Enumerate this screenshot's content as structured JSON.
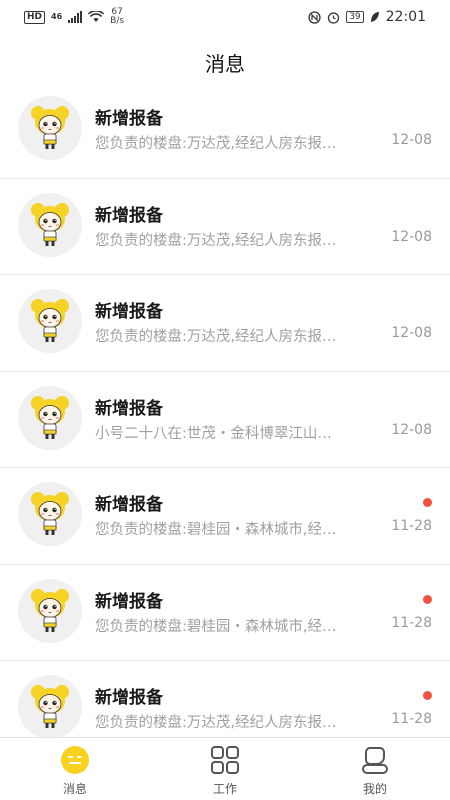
{
  "status_bar": {
    "hd": "HD",
    "network": "46",
    "speed_value": "67",
    "speed_unit": "B/s",
    "battery": "39",
    "time": "22:01"
  },
  "header": {
    "title": "消息"
  },
  "messages": [
    {
      "title": "新增报备",
      "preview": "您负责的楼盘:万达茂,经纪人房东报…",
      "time": "12-08",
      "unread": false,
      "avatar": "bear-avatar-icon"
    },
    {
      "title": "新增报备",
      "preview": "您负责的楼盘:万达茂,经纪人房东报…",
      "time": "12-08",
      "unread": false,
      "avatar": "bear-avatar-icon"
    },
    {
      "title": "新增报备",
      "preview": "您负责的楼盘:万达茂,经纪人房东报…",
      "time": "12-08",
      "unread": false,
      "avatar": "bear-avatar-icon"
    },
    {
      "title": "新增报备",
      "preview": "小号二十八在:世茂・金科博翠江山…",
      "time": "12-08",
      "unread": false,
      "avatar": "bear-avatar-icon"
    },
    {
      "title": "新增报备",
      "preview": "您负责的楼盘:碧桂园・森林城市,经…",
      "time": "11-28",
      "unread": true,
      "avatar": "bear-avatar-icon"
    },
    {
      "title": "新增报备",
      "preview": "您负责的楼盘:碧桂园・森林城市,经…",
      "time": "11-28",
      "unread": true,
      "avatar": "bear-avatar-icon"
    },
    {
      "title": "新增报备",
      "preview": "您负责的楼盘:万达茂,经纪人房东报…",
      "time": "11-28",
      "unread": true,
      "avatar": "bear-avatar-icon"
    }
  ],
  "tabs": [
    {
      "label": "消息",
      "icon": "message-icon",
      "active": true
    },
    {
      "label": "工作",
      "icon": "grid-icon",
      "active": false
    },
    {
      "label": "我的",
      "icon": "profile-icon",
      "active": false
    }
  ],
  "colors": {
    "accent": "#f8d21e",
    "unread_dot": "#f0533b",
    "secondary_text": "#a0a0a0"
  }
}
